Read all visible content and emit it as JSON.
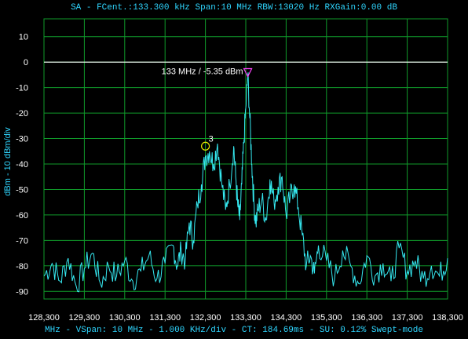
{
  "header": "SA - FCent.:133.300 kHz Span:10 MHz RBW:13020 Hz RXGain:0.00 dB",
  "footer": "MHz - VSpan: 10 MHz - 1.000 KHz/div - CT: 184.69ms - SU: 0.12% Swept-mode",
  "colors": {
    "trace": "#35e8f0",
    "grid": "#0f9a2a",
    "accent": "#2fd6ff",
    "ref_line": "#ffffff",
    "marker": "#ff44ff",
    "marker3": "#e8e800"
  },
  "chart_data": {
    "type": "line",
    "ylabel": "dBm - 10 dBm/div",
    "xlabel": "",
    "xlim": [
      128.3,
      138.3
    ],
    "ylim": [
      -93,
      17
    ],
    "x_ticks": [
      "128,300",
      "129,300",
      "130,300",
      "131,300",
      "132,300",
      "133,300",
      "134,300",
      "135,300",
      "136,300",
      "137,300",
      "138,300"
    ],
    "y_ticks": [
      10,
      0,
      -10,
      -20,
      -30,
      -40,
      -50,
      -60,
      -70,
      -80,
      -90
    ],
    "reference_line_dbm": 0,
    "grid": true,
    "markers": [
      {
        "id": "peak",
        "label": "133 MHz / -5.35 dBm",
        "x": 133.35,
        "y": -5.35,
        "shape": "triangle"
      },
      {
        "id": "3",
        "label": "3",
        "x": 132.3,
        "y": -33,
        "shape": "circle"
      }
    ],
    "series": [
      {
        "x": [
          128.3,
          128.5,
          128.7,
          128.9,
          129.1,
          129.3,
          129.5,
          129.7,
          129.9,
          130.1,
          130.3,
          130.5,
          130.7,
          130.9,
          131.1,
          131.3,
          131.5,
          131.6,
          131.7,
          131.8,
          131.9,
          132.0,
          132.1,
          132.2,
          132.3,
          132.4,
          132.5,
          132.6,
          132.7,
          132.8,
          132.9,
          133.0,
          133.05,
          133.1,
          133.15,
          133.2,
          133.25,
          133.3,
          133.35,
          133.4,
          133.45,
          133.5,
          133.55,
          133.6,
          133.7,
          133.8,
          133.9,
          134.0,
          134.1,
          134.2,
          134.3,
          134.4,
          134.5,
          134.6,
          134.7,
          134.8,
          134.9,
          135.0,
          135.1,
          135.3,
          135.5,
          135.7,
          135.9,
          136.1,
          136.3,
          136.5,
          136.7,
          136.9,
          137.1,
          137.3,
          137.5,
          137.7,
          137.9,
          138.1,
          138.3
        ],
        "y": [
          -84,
          -79,
          -86,
          -77,
          -88,
          -81,
          -75,
          -87,
          -80,
          -84,
          -78,
          -86,
          -82,
          -76,
          -85,
          -79,
          -72,
          -80,
          -74,
          -78,
          -63,
          -70,
          -56,
          -48,
          -37,
          -35,
          -40,
          -32,
          -47,
          -58,
          -48,
          -33,
          -45,
          -56,
          -62,
          -48,
          -32,
          -18,
          -5,
          -22,
          -40,
          -55,
          -63,
          -58,
          -54,
          -62,
          -46,
          -55,
          -49,
          -45,
          -60,
          -53,
          -48,
          -57,
          -68,
          -80,
          -76,
          -83,
          -72,
          -78,
          -85,
          -74,
          -80,
          -87,
          -76,
          -84,
          -79,
          -86,
          -73,
          -82,
          -78,
          -85,
          -80,
          -84,
          -77
        ]
      }
    ]
  }
}
